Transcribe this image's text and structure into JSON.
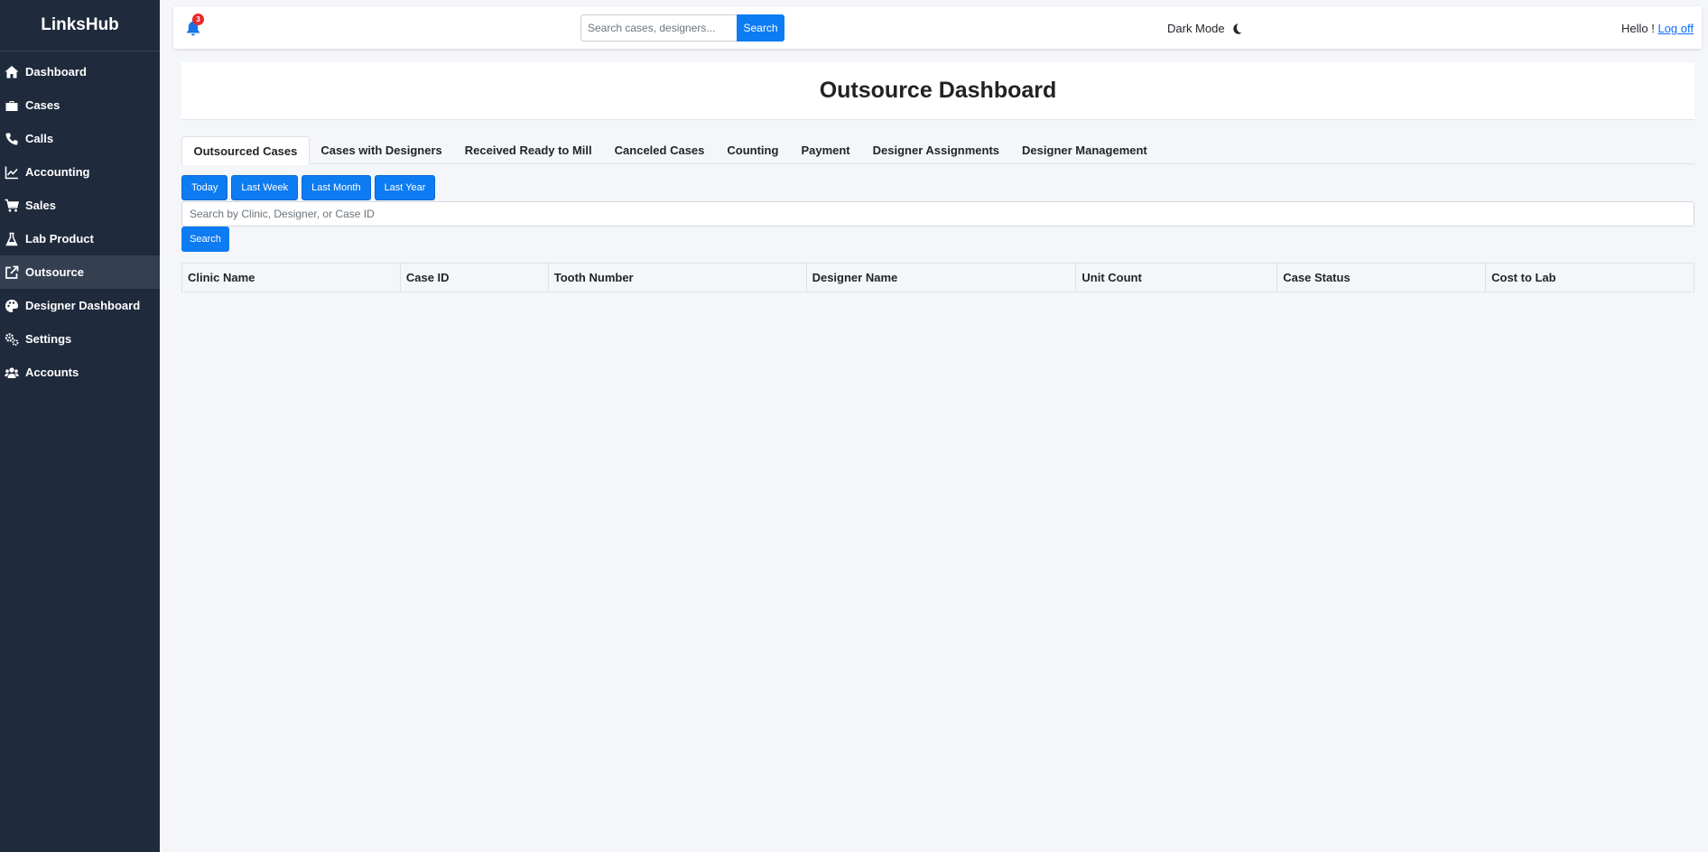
{
  "brand": "LinksHub",
  "sidebar": {
    "items": [
      {
        "label": "Dashboard",
        "icon": "home-icon"
      },
      {
        "label": "Cases",
        "icon": "briefcase-icon"
      },
      {
        "label": "Calls",
        "icon": "phone-icon"
      },
      {
        "label": "Accounting",
        "icon": "chart-line-icon"
      },
      {
        "label": "Sales",
        "icon": "cart-icon"
      },
      {
        "label": "Lab Product",
        "icon": "flask-icon"
      },
      {
        "label": "Outsource",
        "icon": "external-link-icon",
        "active": true
      },
      {
        "label": "Designer Dashboard",
        "icon": "palette-icon"
      },
      {
        "label": "Settings",
        "icon": "gears-icon"
      },
      {
        "label": "Accounts",
        "icon": "users-icon"
      }
    ]
  },
  "topbar": {
    "notification_count": "3",
    "search_placeholder": "Search cases, designers...",
    "search_label": "Search",
    "dark_mode_label": "Dark Mode",
    "greeting": "Hello ! ",
    "logoff_label": "Log off"
  },
  "page": {
    "title": "Outsource Dashboard"
  },
  "tabs": [
    {
      "label": "Outsourced Cases",
      "active": true
    },
    {
      "label": "Cases with Designers"
    },
    {
      "label": "Received Ready to Mill"
    },
    {
      "label": "Canceled Cases"
    },
    {
      "label": "Counting"
    },
    {
      "label": "Payment"
    },
    {
      "label": "Designer Assignments"
    },
    {
      "label": "Designer Management"
    }
  ],
  "filters": [
    "Today",
    "Last Week",
    "Last Month",
    "Last Year"
  ],
  "search": {
    "placeholder": "Search by Clinic, Designer, or Case ID",
    "button_label": "Search"
  },
  "table": {
    "columns": [
      "Clinic Name",
      "Case ID",
      "Tooth Number",
      "Designer Name",
      "Unit Count",
      "Case Status",
      "Cost to Lab"
    ]
  },
  "colors": {
    "sidebar_bg": "#1f2a3c",
    "primary": "#0d7bf2",
    "badge": "#e52b2b"
  }
}
